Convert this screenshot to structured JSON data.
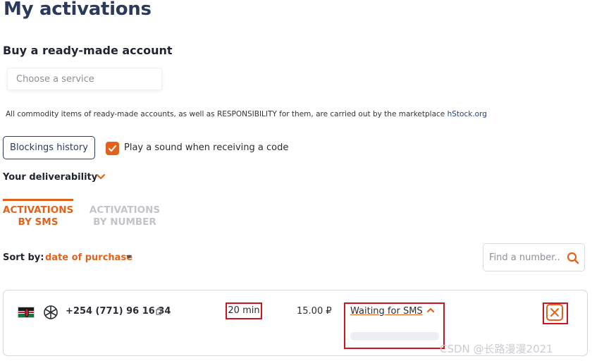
{
  "page": {
    "title": "My activations",
    "subtitle": "Buy a ready-made account"
  },
  "service_search": {
    "placeholder": "Choose a service",
    "value": ""
  },
  "notice": {
    "text": "All commodity items of ready-made accounts, as well as RESPONSIBILITY for them, are carried out by the marketplace ",
    "link": "hStock.org"
  },
  "actions": {
    "blockings_history": "Blockings history",
    "play_sound_label": "Play a sound when receiving a code",
    "play_sound_checked": true
  },
  "deliverability": {
    "label": "Your deliverability"
  },
  "tabs": [
    {
      "line1": "ACTIVATIONS",
      "line2": "BY SMS",
      "active": true
    },
    {
      "line1": "ACTIVATIONS",
      "line2": "BY NUMBER",
      "active": false
    }
  ],
  "sort": {
    "label": "Sort by:",
    "value": "date of purchase"
  },
  "find": {
    "placeholder": "Find a number...",
    "value": ""
  },
  "activations": [
    {
      "country_flag": "kenya-flag",
      "service_icon": "openai-icon",
      "phone": "+254 (771) 96 16 34",
      "time_left": "20 min",
      "price": "15.00 ₽",
      "status": "Waiting for SMS",
      "progress": 0.0
    }
  ],
  "watermark": "CSDN @长路漫漫2021",
  "colors": {
    "accent": "#e2621b",
    "heading": "#2b3a5c",
    "annotation_red": "#d0141f",
    "muted_tab": "#c2c4c9"
  }
}
